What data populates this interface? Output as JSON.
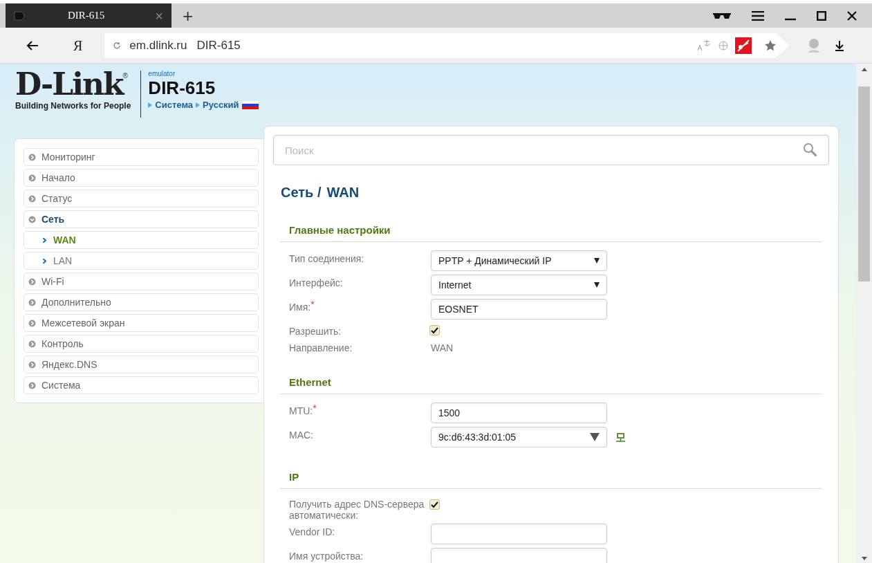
{
  "browser": {
    "tab": {
      "title": "DIR-615",
      "close": "×"
    },
    "new_tab": "+",
    "nav_logo": "Я",
    "address": {
      "host": "em.dlink.ru",
      "title": "DIR-615"
    }
  },
  "header": {
    "logo": "D-Link",
    "logo_mark": "®",
    "tagline": "Building Networks for People",
    "emulator": "emulator",
    "model": "DIR-615",
    "breadcrumbs": [
      "Система",
      "Русский"
    ]
  },
  "sidebar": {
    "items": [
      {
        "label": "Мониторинг",
        "selected": false,
        "expanded": false
      },
      {
        "label": "Начало",
        "selected": false,
        "expanded": false
      },
      {
        "label": "Статус",
        "selected": false,
        "expanded": false
      },
      {
        "label": "Сеть",
        "selected": false,
        "expanded": true,
        "children": [
          {
            "label": "WAN",
            "selected": true
          },
          {
            "label": "LAN",
            "selected": false
          }
        ]
      },
      {
        "label": "Wi-Fi",
        "selected": false,
        "expanded": false
      },
      {
        "label": "Дополнительно",
        "selected": false,
        "expanded": false
      },
      {
        "label": "Межсетевой экран",
        "selected": false,
        "expanded": false
      },
      {
        "label": "Контроль",
        "selected": false,
        "expanded": false
      },
      {
        "label": "Яндекс.DNS",
        "selected": false,
        "expanded": false
      },
      {
        "label": "Система",
        "selected": false,
        "expanded": false
      }
    ]
  },
  "search": {
    "placeholder": "Поиск"
  },
  "page_title": {
    "section": "Сеть /",
    "page": "WAN"
  },
  "sections": [
    {
      "title": "Главные настройки",
      "fields": [
        {
          "kind": "select",
          "label": "Тип соединения:",
          "value": "PPTP + Динамический IP"
        },
        {
          "kind": "select",
          "label": "Интерфейс:",
          "value": "Internet"
        },
        {
          "kind": "input",
          "label": "Имя:",
          "required_mark": "*",
          "value": "EOSNET"
        },
        {
          "kind": "checkbox",
          "label": "Разрешить:",
          "checked": true
        },
        {
          "kind": "text",
          "label": "Направление:",
          "value": "WAN"
        }
      ]
    },
    {
      "title": "Ethernet",
      "fields": [
        {
          "kind": "input",
          "label": "MTU:",
          "required_mark": "*",
          "value": "1500"
        },
        {
          "kind": "combo",
          "label": "MAC:",
          "value": "9c:d6:43:3d:01:05",
          "device_button": true
        }
      ]
    },
    {
      "title": "IP",
      "fields": [
        {
          "kind": "checkbox",
          "label": "Получить адрес DNS-сервера автоматически:",
          "checked": true
        },
        {
          "kind": "input",
          "label": "Vendor ID:"
        },
        {
          "kind": "input",
          "label": "Имя устройства:"
        }
      ]
    }
  ]
}
